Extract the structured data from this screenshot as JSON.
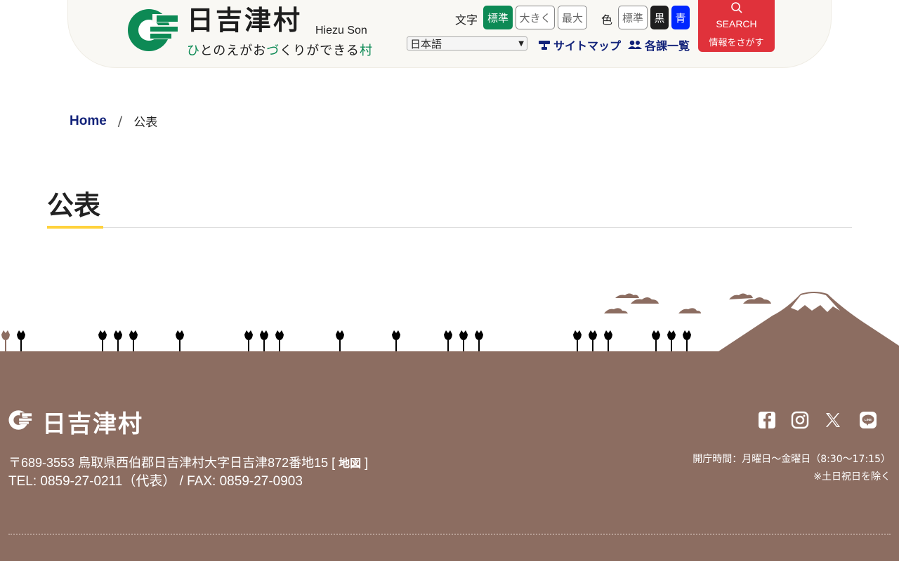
{
  "header": {
    "site_name": "日吉津村",
    "site_name_en": "Hiezu Son",
    "tagline": [
      "ひ",
      "とのえがお",
      "づ",
      "くりができる",
      "村"
    ],
    "text_size_label": "文字",
    "text_sizes": [
      "標準",
      "大きく",
      "最大"
    ],
    "active_text_size": "標準",
    "color_label": "色",
    "colors": [
      "標準",
      "黒",
      "青"
    ],
    "language_selected": "日本語",
    "sitemap_label": "サイトマップ",
    "departments_label": "各課一覧",
    "search_en": "SEARCH",
    "search_jp": "情報をさがす",
    "brand_color": "#0d8a55",
    "search_color": "#e0323b"
  },
  "breadcrumb": {
    "home": "Home",
    "separator": "/",
    "current": "公表"
  },
  "page": {
    "title": "公表"
  },
  "footer": {
    "name": "日吉津村",
    "address": "〒689-3553 鳥取県西伯郡日吉津村大字日吉津872番地15 [ ",
    "map_link": "地図",
    "address_close": " ]",
    "tel_fax": "TEL: 0859-27-0211（代表） / FAX: 0859-27-0903",
    "hours": "開庁時間：月曜日～金曜日（8:30～17:15）",
    "note": "※土日祝日を除く",
    "sns": [
      "facebook-icon",
      "instagram-icon",
      "x-icon",
      "line-icon"
    ],
    "bg_color": "#8c6d61"
  }
}
